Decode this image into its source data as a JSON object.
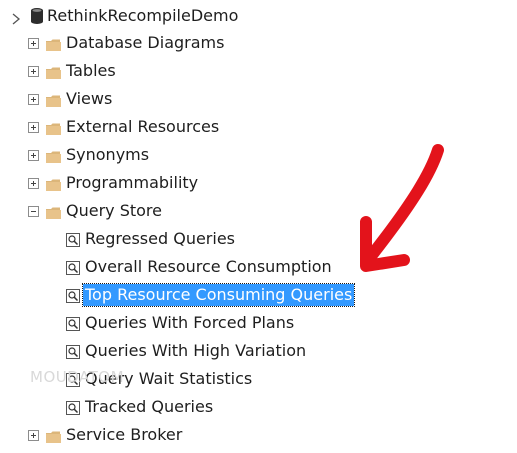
{
  "database": {
    "name": "RethinkRecompileDemo",
    "icon": "database-icon"
  },
  "folders_top": [
    {
      "label": "Database Diagrams",
      "state": "collapsed"
    },
    {
      "label": "Tables",
      "state": "collapsed"
    },
    {
      "label": "Views",
      "state": "collapsed"
    },
    {
      "label": "External Resources",
      "state": "collapsed"
    },
    {
      "label": "Synonyms",
      "state": "collapsed"
    },
    {
      "label": "Programmability",
      "state": "collapsed"
    }
  ],
  "query_store": {
    "label": "Query Store",
    "state": "expanded",
    "children": [
      {
        "label": "Regressed Queries",
        "icon": "query-report-icon"
      },
      {
        "label": "Overall Resource Consumption",
        "icon": "query-report-icon"
      },
      {
        "label": "Top Resource Consuming Queries",
        "icon": "query-report-icon",
        "selected": true
      },
      {
        "label": "Queries With Forced Plans",
        "icon": "query-report-icon"
      },
      {
        "label": "Queries With High Variation",
        "icon": "query-report-icon"
      },
      {
        "label": "Query Wait Statistics",
        "icon": "query-report-icon"
      },
      {
        "label": "Tracked Queries",
        "icon": "query-report-icon"
      }
    ]
  },
  "service_broker": {
    "label": "Service Broker",
    "state": "collapsed"
  },
  "watermark": "MOUDATOM",
  "colors": {
    "selection": "#3399ff",
    "folder": "#dcb67a",
    "arrow": "#e3131b"
  }
}
